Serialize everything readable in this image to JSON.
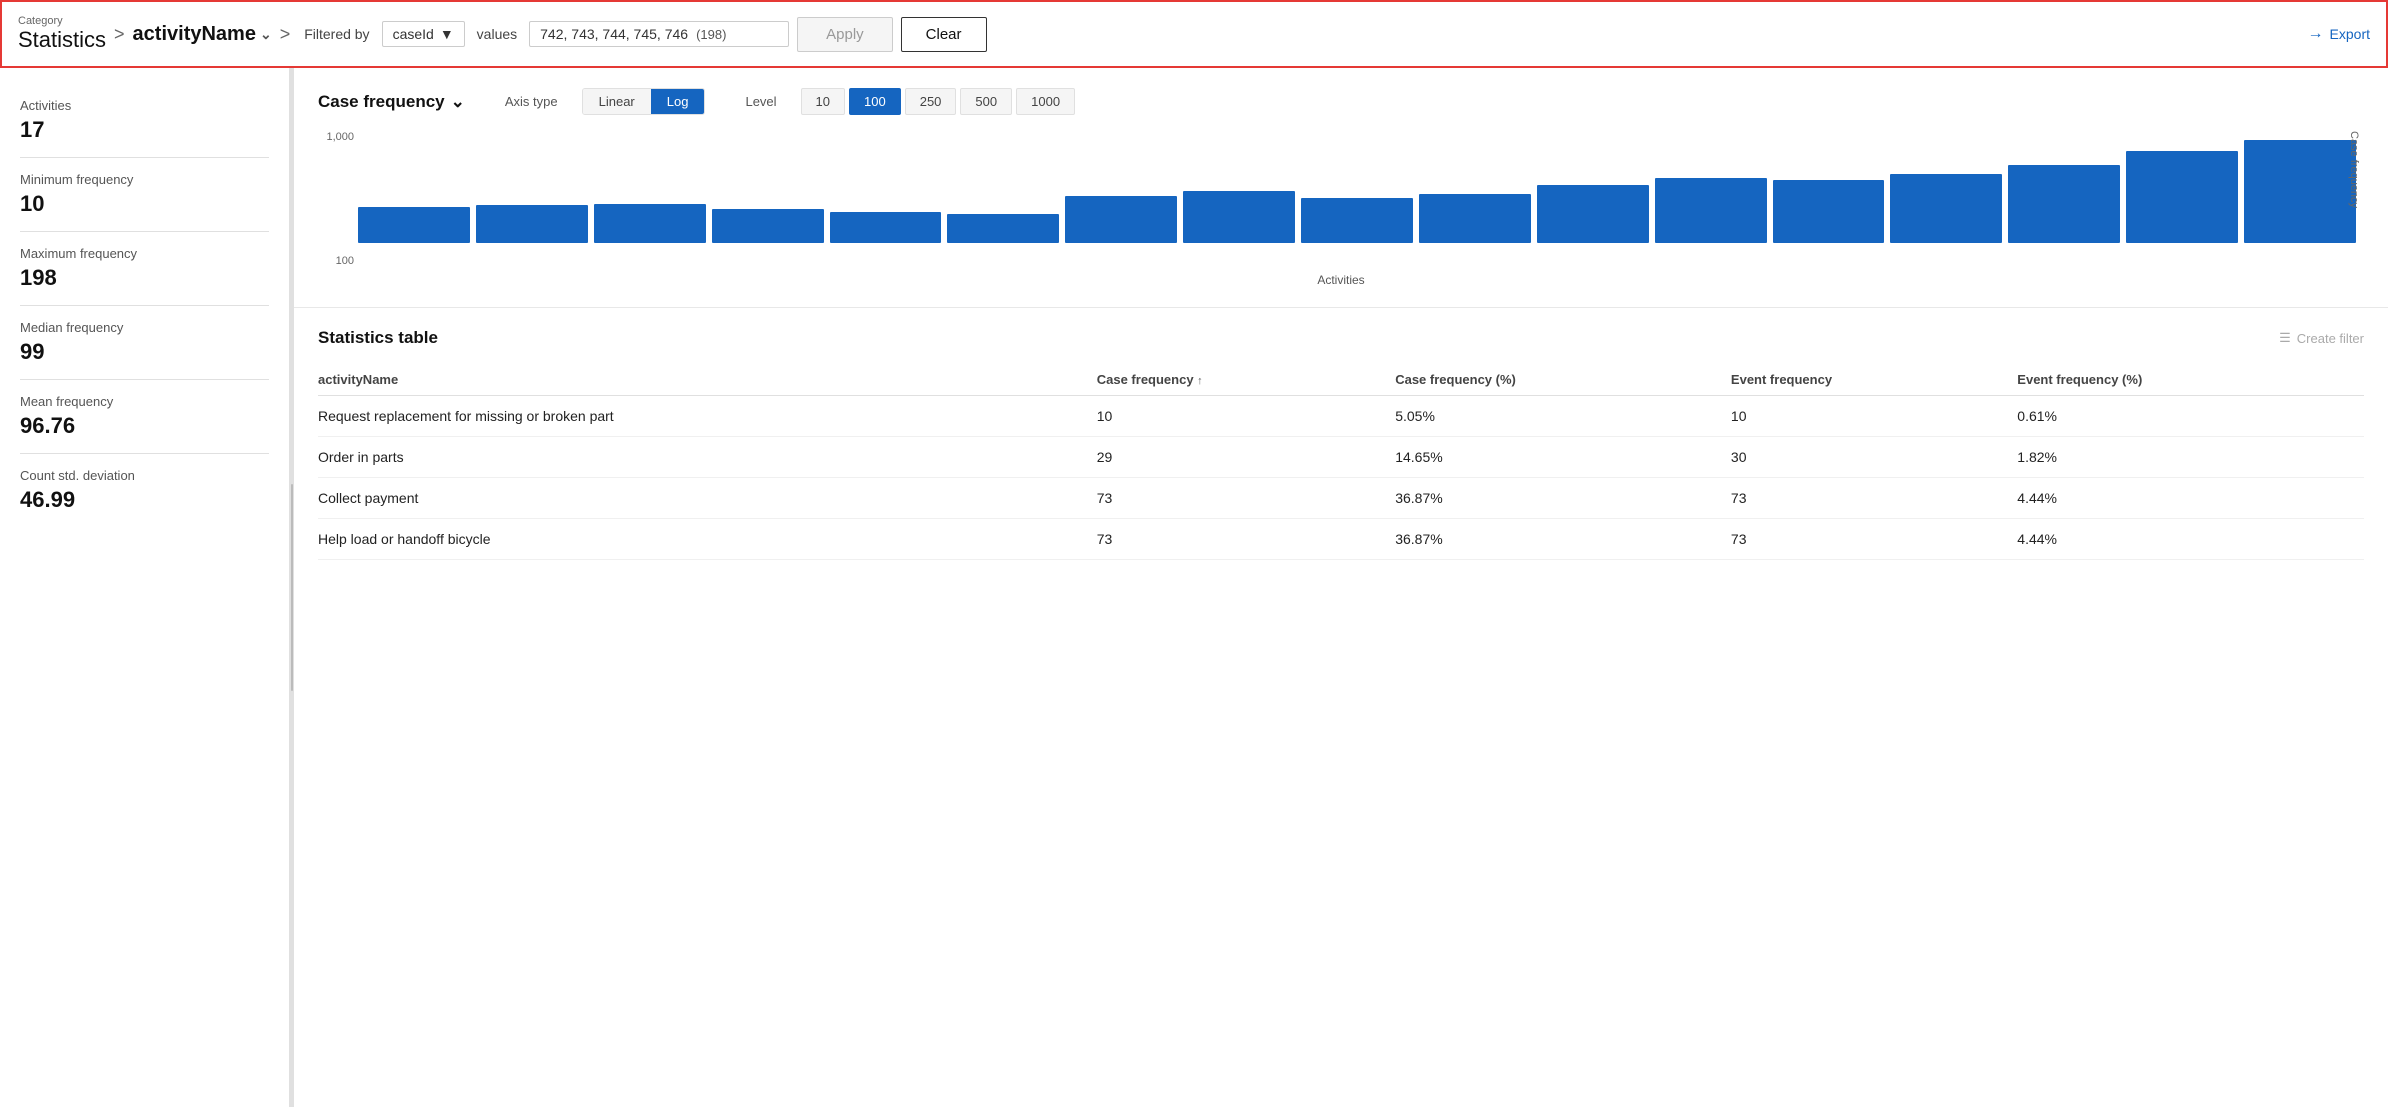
{
  "header": {
    "category_label": "Category",
    "breadcrumb_root": "Statistics",
    "breadcrumb_sep1": ">",
    "activity_name": "activityName",
    "breadcrumb_sep2": ">",
    "filtered_by": "Filtered by",
    "filter_field": "caseId",
    "values_label": "values",
    "values_text": "742, 743, 744, 745, 746",
    "values_count": "(198)",
    "apply_label": "Apply",
    "clear_label": "Clear",
    "export_label": "Export"
  },
  "sidebar": {
    "stats": [
      {
        "label": "Activities",
        "value": "17"
      },
      {
        "label": "Minimum frequency",
        "value": "10"
      },
      {
        "label": "Maximum frequency",
        "value": "198"
      },
      {
        "label": "Median frequency",
        "value": "99"
      },
      {
        "label": "Mean frequency",
        "value": "96.76"
      },
      {
        "label": "Count std. deviation",
        "value": "46.99"
      }
    ]
  },
  "chart": {
    "title": "Case frequency",
    "axis_type_label": "Axis type",
    "axis_linear": "Linear",
    "axis_log": "Log",
    "axis_active": "Log",
    "level_label": "Level",
    "levels": [
      "10",
      "100",
      "250",
      "500",
      "1000"
    ],
    "level_active": "100",
    "x_axis_label": "Activities",
    "y_axis_label": "Case frequency",
    "y_vals": [
      "1,000",
      "100"
    ],
    "bars": [
      28,
      30,
      32,
      28,
      26,
      24,
      40,
      44,
      38,
      42,
      50,
      56,
      54,
      60,
      68,
      80,
      90
    ]
  },
  "table": {
    "title": "Statistics table",
    "create_filter_label": "Create filter",
    "columns": [
      {
        "key": "activityName",
        "label": "activityName",
        "sort": false
      },
      {
        "key": "caseFreq",
        "label": "Case frequency",
        "sort": true
      },
      {
        "key": "caseFreqPct",
        "label": "Case frequency (%)",
        "sort": false
      },
      {
        "key": "eventFreq",
        "label": "Event frequency",
        "sort": false
      },
      {
        "key": "eventFreqPct",
        "label": "Event frequency (%)",
        "sort": false
      }
    ],
    "rows": [
      {
        "activityName": "Request replacement for missing or broken part",
        "caseFreq": "10",
        "caseFreqPct": "5.05%",
        "eventFreq": "10",
        "eventFreqPct": "0.61%"
      },
      {
        "activityName": "Order in parts",
        "caseFreq": "29",
        "caseFreqPct": "14.65%",
        "eventFreq": "30",
        "eventFreqPct": "1.82%"
      },
      {
        "activityName": "Collect payment",
        "caseFreq": "73",
        "caseFreqPct": "36.87%",
        "eventFreq": "73",
        "eventFreqPct": "4.44%"
      },
      {
        "activityName": "Help load or handoff bicycle",
        "caseFreq": "73",
        "caseFreqPct": "36.87%",
        "eventFreq": "73",
        "eventFreqPct": "4.44%"
      }
    ]
  }
}
